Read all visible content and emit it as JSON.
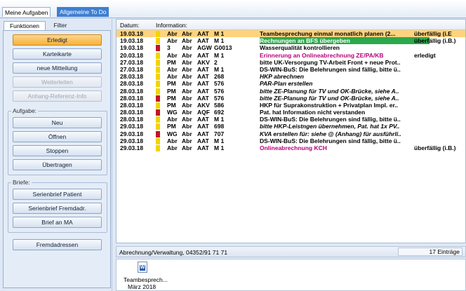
{
  "top_tabs": [
    "Meine Aufgaben",
    "Allgemeine To Do"
  ],
  "left": {
    "tabs": [
      "Funktionen",
      "Filter"
    ],
    "buttons": {
      "erledigt": "Erledigt",
      "karteikarte": "Karteikarte",
      "neue_mitteilung": "neue Mitteilung",
      "weiterleiten": "Weiterleiten",
      "anhang": "Anhang-Referenz-Info"
    },
    "aufgabe_label": "Aufgabe:",
    "aufgabe_buttons": [
      "Neu",
      "Öffnen",
      "Stoppen",
      "Übertragen"
    ],
    "briefe_label": "Briefe:",
    "briefe_buttons": [
      "Serienbrief Patient",
      "Serienbrief Fremdadr.",
      "Brief an MA"
    ],
    "fremdadressen": "Fremdadressen"
  },
  "list": {
    "headers": [
      "Datum:",
      "Information:"
    ],
    "rows": [
      {
        "date": "19.03.18",
        "flag": "yellow",
        "a": "Abr",
        "b": "Abr",
        "c": "AAT",
        "d": "M 1",
        "info": "Teambesprechung einmal monatlich planen (2...",
        "state": "überfällig (i.E",
        "style": "hl"
      },
      {
        "date": "19.03.18",
        "flag": "yellow",
        "a": "Abr",
        "b": "Abr",
        "c": "AAT",
        "d": "M 1",
        "info": "Rechnungen an BFS übergeben",
        "state": "überfällig (i.B.)",
        "style": "green"
      },
      {
        "date": "19.03.18",
        "flag": "red",
        "a": "3",
        "b": "Abr",
        "c": "AGW",
        "d": "G0013",
        "info": "Wasserqualität kontrollieren",
        "state": "",
        "style": ""
      },
      {
        "date": "20.03.18",
        "flag": "yellow",
        "a": "Abr",
        "b": "Abr",
        "c": "AAT",
        "d": "M 1",
        "info": "Erinnerung an Onlineabrechnung ZE/PA/KB",
        "state": "erledigt",
        "style": "magenta"
      },
      {
        "date": "27.03.18",
        "flag": "yellow",
        "a": "PM",
        "b": "Abr",
        "c": "AKV",
        "d": "2",
        "info": "bitte UK-Versorgung TV-Arbeit Front + neue Prot..",
        "state": "",
        "style": ""
      },
      {
        "date": "27.03.18",
        "flag": "yellow",
        "a": "Abr",
        "b": "Abr",
        "c": "AAT",
        "d": "M 1",
        "info": "DS-WIN-BuS: Die Belehrungen sind fällig, bitte ü..",
        "state": "",
        "style": ""
      },
      {
        "date": "28.03.18",
        "flag": "yellow",
        "a": "Abr",
        "b": "Abr",
        "c": "AAT",
        "d": "268",
        "info": "HKP abrechnen",
        "state": "",
        "style": "italic"
      },
      {
        "date": "28.03.18",
        "flag": "yellow",
        "a": "PM",
        "b": "Abr",
        "c": "AAT",
        "d": "576",
        "info": "PAR-Plan erstellen",
        "state": "",
        "style": "italic"
      },
      {
        "date": "28.03.18",
        "flag": "yellow",
        "a": "PM",
        "b": "Abr",
        "c": "AAT",
        "d": "576",
        "info": "bitte ZE-Planung für TV und OK-Brücke, siehe A..",
        "state": "",
        "style": "italic"
      },
      {
        "date": "28.03.18",
        "flag": "red",
        "a": "PM",
        "b": "Abr",
        "c": "AAT",
        "d": "576",
        "info": "bitte ZE-Planung für TV und OK-Brücke, siehe A..",
        "state": "",
        "style": "italic"
      },
      {
        "date": "28.03.18",
        "flag": "yellow",
        "a": "PM",
        "b": "Abr",
        "c": "AKV",
        "d": "586",
        "info": "HKP für Suprakonstruktion + Privatplan Impl. er..",
        "state": "",
        "style": ""
      },
      {
        "date": "28.03.18",
        "flag": "red",
        "a": "WG",
        "b": "Abr",
        "c": "AQF",
        "d": "692",
        "info": "Pat. hat Information nicht verstanden",
        "state": "",
        "style": ""
      },
      {
        "date": "28.03.18",
        "flag": "yellow",
        "a": "Abr",
        "b": "Abr",
        "c": "AAT",
        "d": "M 1",
        "info": "DS-WIN-BuS: Die Belehrungen sind fällig, bitte ü..",
        "state": "",
        "style": ""
      },
      {
        "date": "29.03.18",
        "flag": "yellow",
        "a": "PM",
        "b": "Abr",
        "c": "AAT",
        "d": "698",
        "info": "bitte HKP-Leistngen übernehmen, Pat. hat 1x PV..",
        "state": "",
        "style": "italic"
      },
      {
        "date": "29.03.18",
        "flag": "red",
        "a": "WG",
        "b": "Abr",
        "c": "AAT",
        "d": "707",
        "info": "KVA erstellen für: siehe @ (Anhang) für ausführli..",
        "state": "",
        "style": "italic"
      },
      {
        "date": "29.03.18",
        "flag": "yellow",
        "a": "Abr",
        "b": "Abr",
        "c": "AAT",
        "d": "M 1",
        "info": "DS-WIN-BuS: Die Belehrungen sind fällig, bitte ü..",
        "state": "",
        "style": ""
      },
      {
        "date": "29.03.18",
        "flag": "yellow",
        "a": "Abr",
        "b": "Abr",
        "c": "AAT",
        "d": "M 1",
        "info": "Onlineabrechnung KCH",
        "state": "überfällig (i.B.)",
        "style": "magenta"
      }
    ]
  },
  "status": {
    "left": "Abrechnung/Verwaltung, 04352/91 71 71",
    "right": "17 Einträge"
  },
  "attachment": {
    "name": "Teambesprech...",
    "date": "März 2018"
  },
  "colors": {
    "highlight_row": "#ffd37d",
    "green_info": "#2ca84a",
    "magenta_text": "#b8007a",
    "flag_yellow": "#f2d400",
    "flag_red": "#c4122f"
  }
}
